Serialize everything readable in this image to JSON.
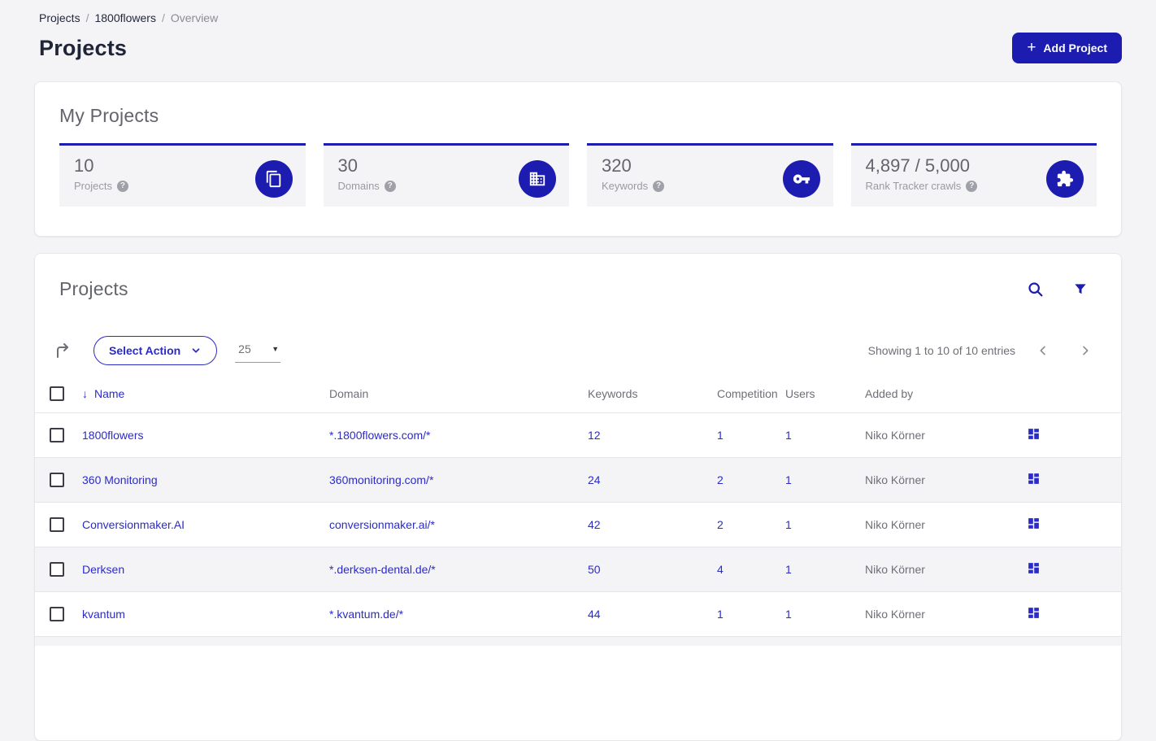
{
  "breadcrumb": {
    "separator": "/",
    "items": [
      "Projects",
      "1800flowers",
      "Overview"
    ]
  },
  "header": {
    "title": "Projects",
    "add_project": "Add Project"
  },
  "stats": {
    "title": "My Projects",
    "cards": [
      {
        "value": "10",
        "label": "Projects",
        "icon": "projects-copy-icon"
      },
      {
        "value": "30",
        "label": "Domains",
        "icon": "domain-building-icon"
      },
      {
        "value": "320",
        "label": "Keywords",
        "icon": "key-icon"
      },
      {
        "value": "4,897 / 5,000",
        "label": "Rank Tracker crawls",
        "icon": "puzzle-icon"
      }
    ]
  },
  "panel": {
    "title": "Projects",
    "select_action": "Select Action",
    "page_size": "25",
    "showing": "Showing 1 to 10 of 10 entries",
    "columns": {
      "name": "Name",
      "domain": "Domain",
      "keywords": "Keywords",
      "competition": "Competition",
      "users": "Users",
      "added_by": "Added by"
    },
    "rows": [
      {
        "name": "1800flowers",
        "domain": "*.1800flowers.com/*",
        "keywords": "12",
        "competition": "1",
        "users": "1",
        "added_by": "Niko Körner"
      },
      {
        "name": "360 Monitoring",
        "domain": "360monitoring.com/*",
        "keywords": "24",
        "competition": "2",
        "users": "1",
        "added_by": "Niko Körner"
      },
      {
        "name": "Conversionmaker.AI",
        "domain": "conversionmaker.ai/*",
        "keywords": "42",
        "competition": "2",
        "users": "1",
        "added_by": "Niko Körner"
      },
      {
        "name": "Derksen",
        "domain": "*.derksen-dental.de/*",
        "keywords": "50",
        "competition": "4",
        "users": "1",
        "added_by": "Niko Körner"
      },
      {
        "name": "kvantum",
        "domain": "*.kvantum.de/*",
        "keywords": "44",
        "competition": "1",
        "users": "1",
        "added_by": "Niko Körner"
      }
    ]
  },
  "colors": {
    "brand": "#1c1cb0",
    "link": "#2b2bc8",
    "page_bg": "#f4f4f6"
  }
}
